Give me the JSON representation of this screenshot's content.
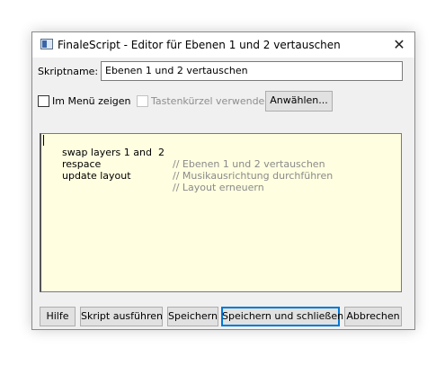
{
  "window": {
    "title": "FinaleScript - Editor für Ebenen 1 und 2 vertauschen",
    "close_glyph": "✕"
  },
  "script_name": {
    "label": "Skriptname:",
    "value": "Ebenen 1 und 2 vertauschen"
  },
  "options": {
    "show_in_menu_label": "Im Menü zeigen",
    "show_in_menu_checked": false,
    "shortcut_label": "Tastenkürzel verwenden",
    "shortcut_checked": false,
    "shortcut_enabled": false,
    "select_button": "Anwählen..."
  },
  "editor": {
    "background": "#fffee0",
    "lines": [
      {
        "code": "swap layers 1 and  2",
        "comment": "// Ebenen 1 und 2 vertauschen"
      },
      {
        "code": "respace",
        "comment": "// Musikausrichtung durchführen"
      },
      {
        "code": "update layout",
        "comment": "// Layout erneuern"
      }
    ]
  },
  "buttons": {
    "help": "Hilfe",
    "run": "Skript ausführen",
    "save": "Speichern",
    "save_close": "Speichern und schließen",
    "cancel": "Abbrechen"
  },
  "colors": {
    "accent": "#0078d7",
    "comment": "#8a8a8a"
  }
}
